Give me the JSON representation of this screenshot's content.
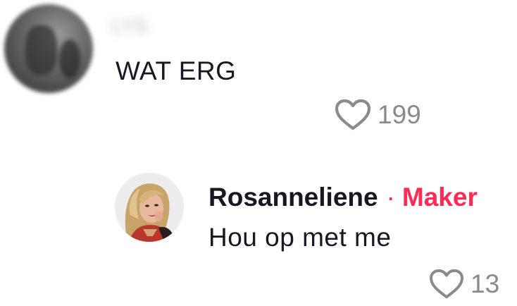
{
  "comment": {
    "username": "LYS",
    "text": "WAT ERG",
    "likes": "199"
  },
  "reply": {
    "username": "Rosanneliene",
    "separator": "·",
    "badge": "Maker",
    "text": "Hou op met me",
    "likes": "13"
  },
  "colors": {
    "text": "#161823",
    "muted": "#8a8b91",
    "accent": "#fe2c55"
  },
  "icons": {
    "like": "heart-outline-icon"
  }
}
